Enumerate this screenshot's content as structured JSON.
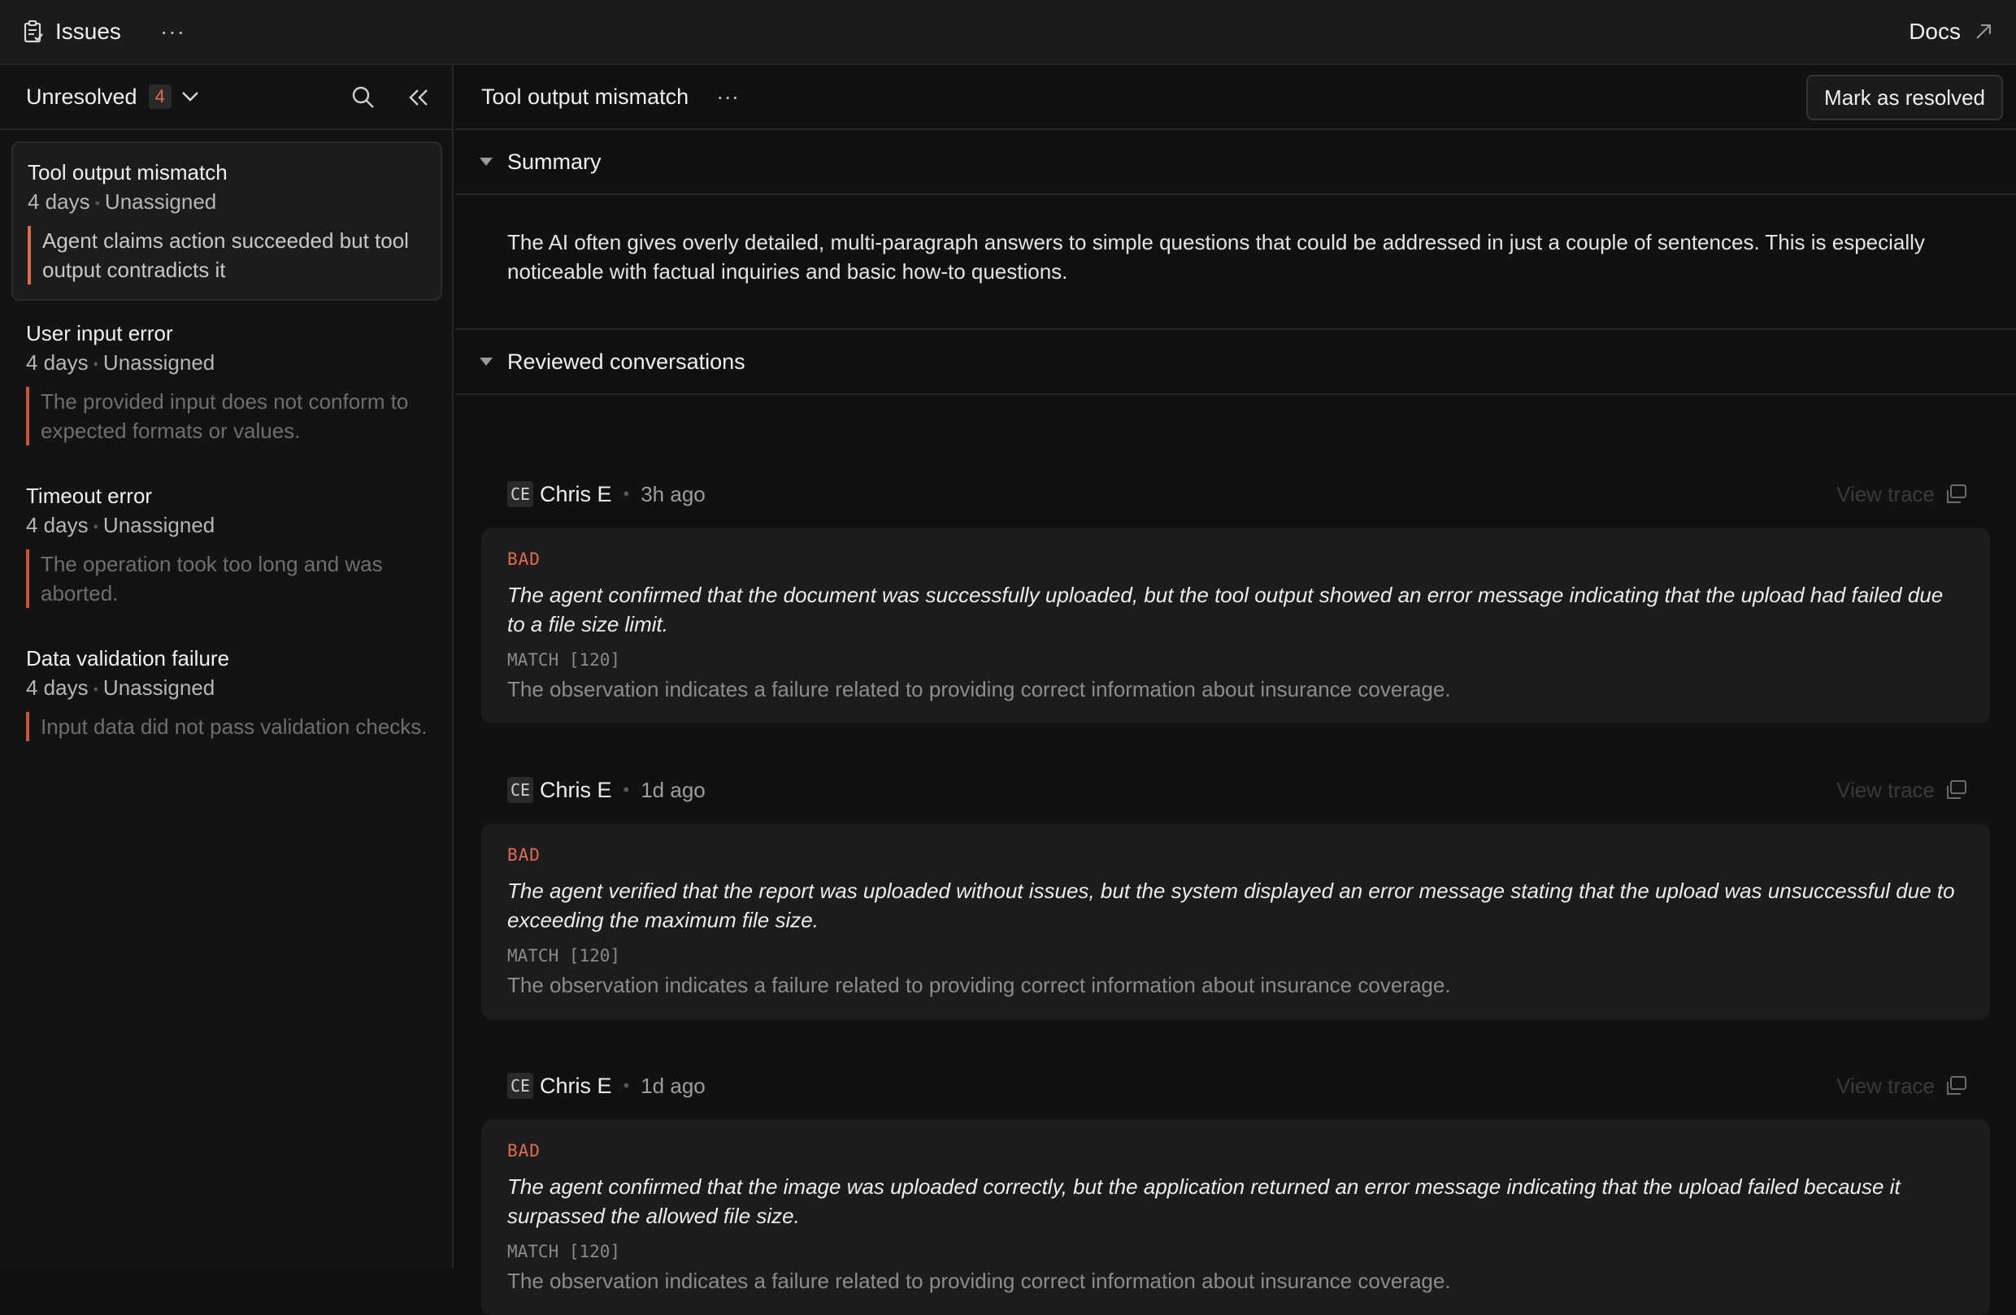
{
  "topbar": {
    "title": "Issues",
    "docs_label": "Docs"
  },
  "sidebar": {
    "filter_label": "Unresolved",
    "count": "4",
    "issues": [
      {
        "title": "Tool output mismatch",
        "age": "4 days",
        "assignee": "Unassigned",
        "description": "Agent claims action succeeded but tool output contradicts it"
      },
      {
        "title": "User input error",
        "age": "4 days",
        "assignee": "Unassigned",
        "description": "The provided input does not conform to expected formats or values."
      },
      {
        "title": "Timeout error",
        "age": "4 days",
        "assignee": "Unassigned",
        "description": "The operation took too long and was aborted."
      },
      {
        "title": "Data validation failure",
        "age": "4 days",
        "assignee": "Unassigned",
        "description": "Input data did not pass validation checks."
      }
    ]
  },
  "main": {
    "title": "Tool output mismatch",
    "resolve_label": "Mark as resolved",
    "summary": {
      "heading": "Summary",
      "text": "The AI often gives overly detailed, multi-paragraph answers to simple questions that could be addressed in just a couple of sentences. This is especially noticeable with factual inquiries and basic how-to questions."
    },
    "reviewed": {
      "heading": "Reviewed conversations",
      "view_trace_label": "View trace",
      "items": [
        {
          "initials": "CE",
          "name": "Chris E",
          "time": "3h ago",
          "rating": "BAD",
          "observation": "The agent confirmed that the document was successfully uploaded, but the tool output showed an error message indicating that the upload had failed due to a file size limit.",
          "match": "MATCH [120]",
          "explanation": "The observation indicates a failure related to providing correct information about insurance coverage."
        },
        {
          "initials": "CE",
          "name": "Chris E",
          "time": "1d ago",
          "rating": "BAD",
          "observation": "The agent verified that the report was uploaded without issues, but the system displayed an error message stating that the upload was unsuccessful due to exceeding the maximum file size.",
          "match": "MATCH [120]",
          "explanation": "The observation indicates a failure related to providing correct information about insurance coverage."
        },
        {
          "initials": "CE",
          "name": "Chris E",
          "time": "1d ago",
          "rating": "BAD",
          "observation": "The agent confirmed that the image was uploaded correctly, but the application returned an error message indicating that the upload failed because it surpassed the allowed file size.",
          "match": "MATCH [120]",
          "explanation": "The observation indicates a failure related to providing correct information about insurance coverage."
        }
      ]
    }
  },
  "colors": {
    "background": "#111111",
    "accent": "#e26a4d",
    "border": "#262626"
  }
}
